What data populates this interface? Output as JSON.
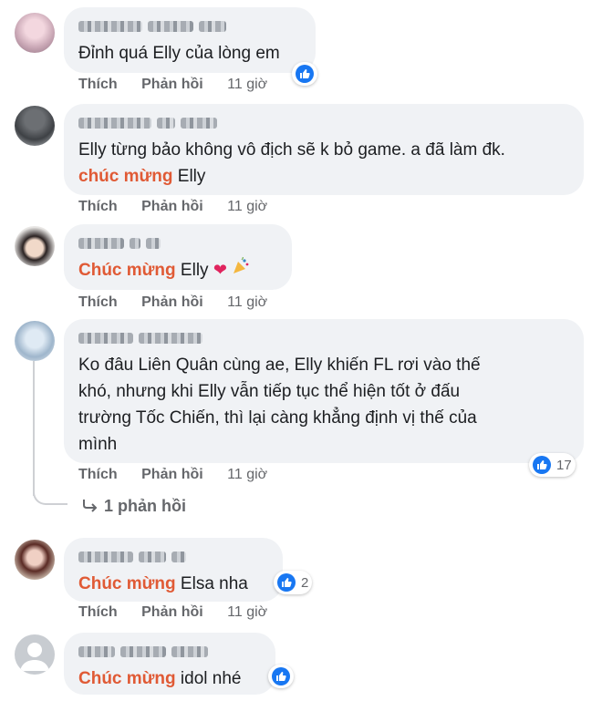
{
  "actions": {
    "like": "Thích",
    "reply": "Phản hồi"
  },
  "comments": [
    {
      "time": "11 giờ",
      "lines": [
        "Đỉnh quá Elly của lòng em"
      ],
      "reaction_count": ""
    },
    {
      "time": "11 giờ",
      "lines": [
        "Elly từng bảo không vô địch sẽ k bỏ game. a đã làm đk."
      ],
      "tag": "chúc mừng",
      "after_tag": " Elly"
    },
    {
      "time": "11 giờ",
      "tag": "Chúc mừng",
      "after_tag": " Elly "
    },
    {
      "time": "11 giờ",
      "lines": [
        "Ko đâu Liên Quân cùng ae, Elly khiến FL rơi vào thế",
        "khó, nhưng khi Elly vẫn tiếp tục thể hiện tốt ở đấu",
        "trường Tốc Chiến, thì lại càng khẳng định vị thế của",
        "mình"
      ],
      "reaction_count": "17"
    },
    {
      "time": "11 giờ",
      "tag": "Chúc mừng",
      "after_tag": " Elsa nha",
      "reaction_count": "2"
    },
    {
      "tag": "Chúc mừng",
      "after_tag": " idol nhé"
    }
  ],
  "replies_link": "1 phản hồi",
  "colors": {
    "tag": "#e05a35",
    "bubble": "#f0f2f5",
    "like": "#1877f2"
  },
  "icons": [
    "like-icon",
    "heart-icon",
    "party-popper-icon",
    "reply-arrow-icon"
  ]
}
